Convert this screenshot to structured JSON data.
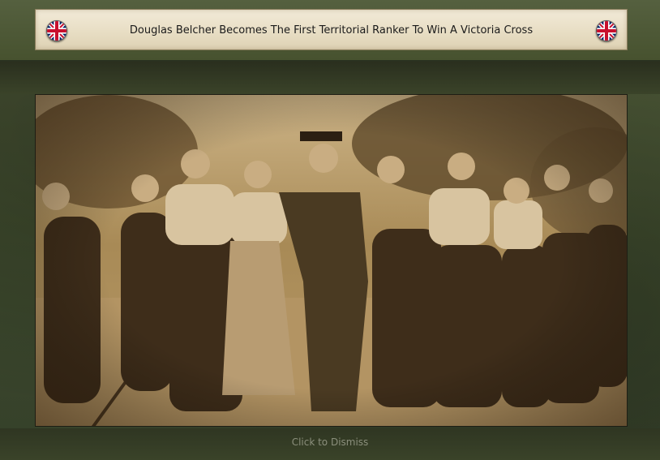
{
  "event": {
    "title": "Douglas Belcher Becomes The First Territorial Ranker To Win A Victoria Cross",
    "left_flag_icon": "union-jack-flag-icon",
    "right_flag_icon": "union-jack-flag-icon",
    "image_icon": "sepia-photograph-soldier-with-women",
    "dismiss_label": "Click to Dismiss"
  },
  "colors": {
    "plate": "#ece3cc",
    "frame": "#45502f",
    "dismiss_text": "#8b8f7c"
  }
}
